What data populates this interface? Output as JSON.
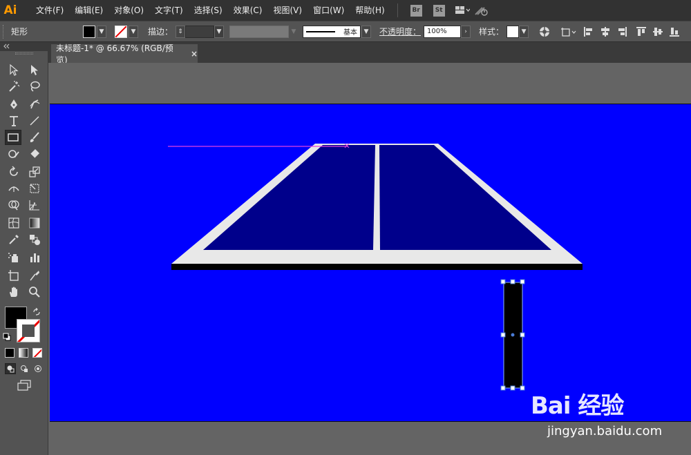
{
  "app": {
    "logo": "Ai"
  },
  "menu": {
    "items": [
      "文件(F)",
      "编辑(E)",
      "对象(O)",
      "文字(T)",
      "选择(S)",
      "效果(C)",
      "视图(V)",
      "窗口(W)",
      "帮助(H)"
    ],
    "bridge_label": "Br",
    "stock_label": "St"
  },
  "control_bar": {
    "tool_name": "矩形",
    "stroke_label": "描边：",
    "stroke_style": "基本",
    "opacity_label": "不透明度：",
    "opacity_value": "100%",
    "style_label": "样式：",
    "fill_color": "#000000"
  },
  "document_tab": {
    "title": "未标题-1* @ 66.67% (RGB/预览)",
    "close": "×"
  },
  "canvas": {
    "artboard_color": "#0000ff",
    "table_color": "#00008b",
    "border_color": "#e6e6e6",
    "leg_color": "#000000"
  },
  "watermark": {
    "logo": "Bai 经验",
    "url": "jingyan.baidu.com"
  }
}
